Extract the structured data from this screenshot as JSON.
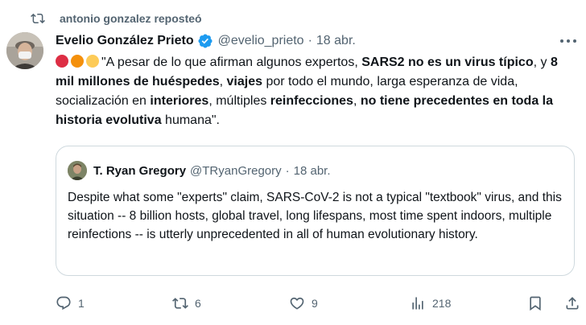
{
  "repost": {
    "text": "antonio gonzalez reposteó"
  },
  "author": {
    "name": "Evelio González Prieto",
    "handle": "@evelio_prieto",
    "separator": "·",
    "date": "18 abr."
  },
  "tweet": {
    "segments": [
      {
        "text": "\"A pesar de lo que afirman algunos expertos, ",
        "bold": false
      },
      {
        "text": "SARS2 no es un virus típico",
        "bold": true
      },
      {
        "text": ", y ",
        "bold": false
      },
      {
        "text": "8 mil millones de huéspedes",
        "bold": true
      },
      {
        "text": ", ",
        "bold": false
      },
      {
        "text": "viajes",
        "bold": true
      },
      {
        "text": " por todo el mundo, larga esperanza de vida, socialización en ",
        "bold": false
      },
      {
        "text": "interiores",
        "bold": true
      },
      {
        "text": ", múltiples ",
        "bold": false
      },
      {
        "text": "reinfecciones",
        "bold": true
      },
      {
        "text": ", ",
        "bold": false
      },
      {
        "text": "no tiene precedentes en toda la historia evolutiva",
        "bold": true
      },
      {
        "text": " humana\".",
        "bold": false
      }
    ],
    "emoji_colors": [
      "#dd2e44",
      "#f4900c",
      "#fdcb58"
    ]
  },
  "quote": {
    "name": "T. Ryan Gregory",
    "handle": "@TRyanGregory",
    "separator": "·",
    "date": "18 abr.",
    "text": "Despite what some \"experts\" claim, SARS-CoV-2 is not a typical \"textbook\" virus, and this situation -- 8 billion hosts, global travel, long lifespans, most time spent indoors, multiple reinfections -- is utterly unprecedented in all of human evolutionary history."
  },
  "actions": {
    "replies": "1",
    "reposts": "6",
    "likes": "9",
    "views": "218"
  },
  "icons": {
    "repost": "repost-icon",
    "verified": "verified-badge-icon",
    "more": "more-icon",
    "reply": "reply-icon",
    "like": "heart-icon",
    "views": "views-icon",
    "bookmark": "bookmark-icon",
    "share": "share-icon"
  },
  "colors": {
    "text": "#0f1419",
    "secondary": "#536471",
    "verified": "#1d9bf0",
    "border": "#cfd9de"
  }
}
